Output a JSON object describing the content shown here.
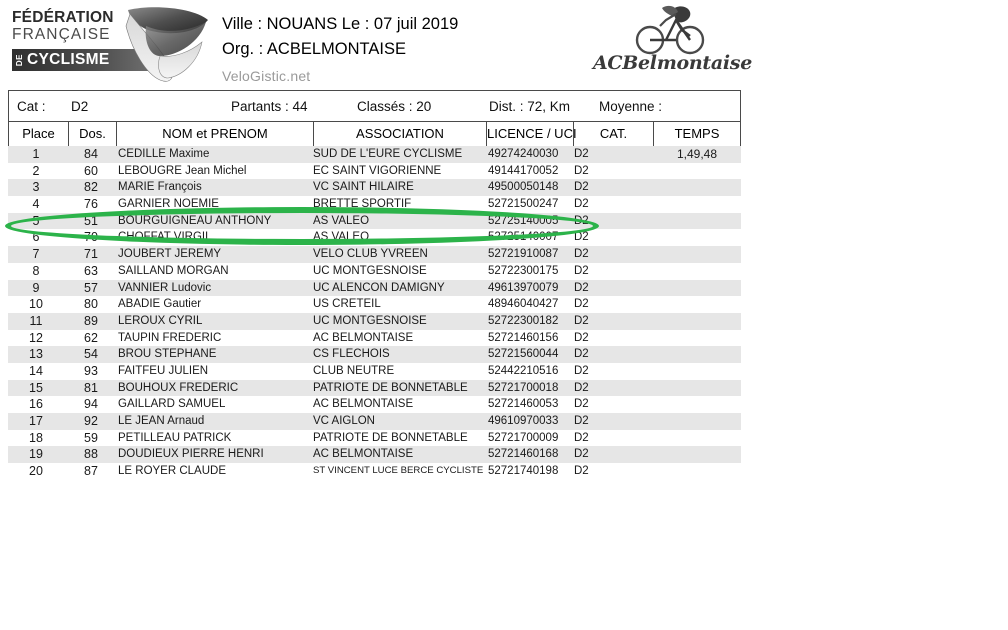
{
  "header": {
    "ffc_logo": {
      "line1": "FÉDÉRATION",
      "line2": "FRANÇAISE",
      "de": "DE",
      "cyclisme": "CYCLISME"
    },
    "ville_line": "Ville :  NOUANS  Le :  07 juil 2019",
    "org_line": "Org. :  ACBELMONTAISE",
    "site": "VeloGistic.net",
    "club_logo": {
      "name": "ACBelmontaise"
    }
  },
  "info": {
    "cat_label": "Cat :",
    "cat_value": "D2",
    "partants": "Partants : 44",
    "classes": "Classés : 20",
    "dist": "Dist. : 72, Km",
    "moyenne": "Moyenne :"
  },
  "table": {
    "columns": [
      {
        "key": "place",
        "label": "Place"
      },
      {
        "key": "dos",
        "label": "Dos."
      },
      {
        "key": "nom",
        "label": "NOM et PRENOM"
      },
      {
        "key": "asso",
        "label": "ASSOCIATION"
      },
      {
        "key": "lic",
        "label": "LICENCE / UCI"
      },
      {
        "key": "cat",
        "label": "CAT."
      },
      {
        "key": "temps",
        "label": "TEMPS"
      }
    ],
    "rows": [
      {
        "place": "1",
        "dos": "84",
        "nom": "CEDILLE   Maxime",
        "asso": "SUD DE L'EURE CYCLISME",
        "lic": "49274240030",
        "cat": "D2",
        "temps": "1,49,48"
      },
      {
        "place": "2",
        "dos": "60",
        "nom": "LEBOUGRE   Jean Michel",
        "asso": "EC SAINT VIGORIENNE",
        "lic": "49144170052",
        "cat": "D2",
        "temps": ""
      },
      {
        "place": "3",
        "dos": "82",
        "nom": "MARIE   François",
        "asso": "VC SAINT HILAIRE",
        "lic": "49500050148",
        "cat": "D2",
        "temps": ""
      },
      {
        "place": "4",
        "dos": "76",
        "nom": "GARNIER   NOEMIE",
        "asso": "BRETTE SPORTIF",
        "lic": "52721500247",
        "cat": "D2",
        "temps": ""
      },
      {
        "place": "5",
        "dos": "51",
        "nom": "BOURGUIGNEAU   ANTHONY",
        "asso": "AS VALEO",
        "lic": "52725140005",
        "cat": "D2",
        "temps": ""
      },
      {
        "place": "6",
        "dos": "70",
        "nom": "CHOFFAT   VIRGIL",
        "asso": "AS VALEO",
        "lic": "52725140007",
        "cat": "D2",
        "temps": ""
      },
      {
        "place": "7",
        "dos": "71",
        "nom": "JOUBERT   JEREMY",
        "asso": "VELO CLUB YVREEN",
        "lic": "52721910087",
        "cat": "D2",
        "temps": ""
      },
      {
        "place": "8",
        "dos": "63",
        "nom": "SAILLAND   MORGAN",
        "asso": "UC MONTGESNOISE",
        "lic": "52722300175",
        "cat": "D2",
        "temps": ""
      },
      {
        "place": "9",
        "dos": "57",
        "nom": "VANNIER   Ludovic",
        "asso": "UC ALENCON DAMIGNY",
        "lic": "49613970079",
        "cat": "D2",
        "temps": ""
      },
      {
        "place": "10",
        "dos": "80",
        "nom": "ABADIE   Gautier",
        "asso": "US CRETEIL",
        "lic": "48946040427",
        "cat": "D2",
        "temps": ""
      },
      {
        "place": "11",
        "dos": "89",
        "nom": "LEROUX   CYRIL",
        "asso": "UC MONTGESNOISE",
        "lic": "52722300182",
        "cat": "D2",
        "temps": ""
      },
      {
        "place": "12",
        "dos": "62",
        "nom": "TAUPIN   FREDERIC",
        "asso": "AC BELMONTAISE",
        "lic": "52721460156",
        "cat": "D2",
        "temps": ""
      },
      {
        "place": "13",
        "dos": "54",
        "nom": "BROU   STEPHANE",
        "asso": "CS FLECHOIS",
        "lic": "52721560044",
        "cat": "D2",
        "temps": ""
      },
      {
        "place": "14",
        "dos": "93",
        "nom": "FAITFEU   JULIEN",
        "asso": "CLUB NEUTRE",
        "lic": "52442210516",
        "cat": "D2",
        "temps": ""
      },
      {
        "place": "15",
        "dos": "81",
        "nom": "BOUHOUX   FREDERIC",
        "asso": "PATRIOTE DE BONNETABLE",
        "lic": "52721700018",
        "cat": "D2",
        "temps": ""
      },
      {
        "place": "16",
        "dos": "94",
        "nom": "GAILLARD   SAMUEL",
        "asso": "AC BELMONTAISE",
        "lic": "52721460053",
        "cat": "D2",
        "temps": ""
      },
      {
        "place": "17",
        "dos": "92",
        "nom": "LE JEAN   Arnaud",
        "asso": "VC AIGLON",
        "lic": "49610970033",
        "cat": "D2",
        "temps": ""
      },
      {
        "place": "18",
        "dos": "59",
        "nom": "PETILLEAU   PATRICK",
        "asso": "PATRIOTE DE BONNETABLE",
        "lic": "52721700009",
        "cat": "D2",
        "temps": ""
      },
      {
        "place": "19",
        "dos": "88",
        "nom": "DOUDIEUX   PIERRE HENRI",
        "asso": "AC BELMONTAISE",
        "lic": "52721460168",
        "cat": "D2",
        "temps": ""
      },
      {
        "place": "20",
        "dos": "87",
        "nom": "LE ROYER   CLAUDE",
        "asso": "ST VINCENT LUCE BERCE CYCLISTE",
        "lic": "52721740198",
        "cat": "D2",
        "temps": ""
      }
    ]
  },
  "annotation": {
    "highlight_color": "#2cb34a",
    "highlighted_places": [
      "5",
      "6"
    ]
  }
}
